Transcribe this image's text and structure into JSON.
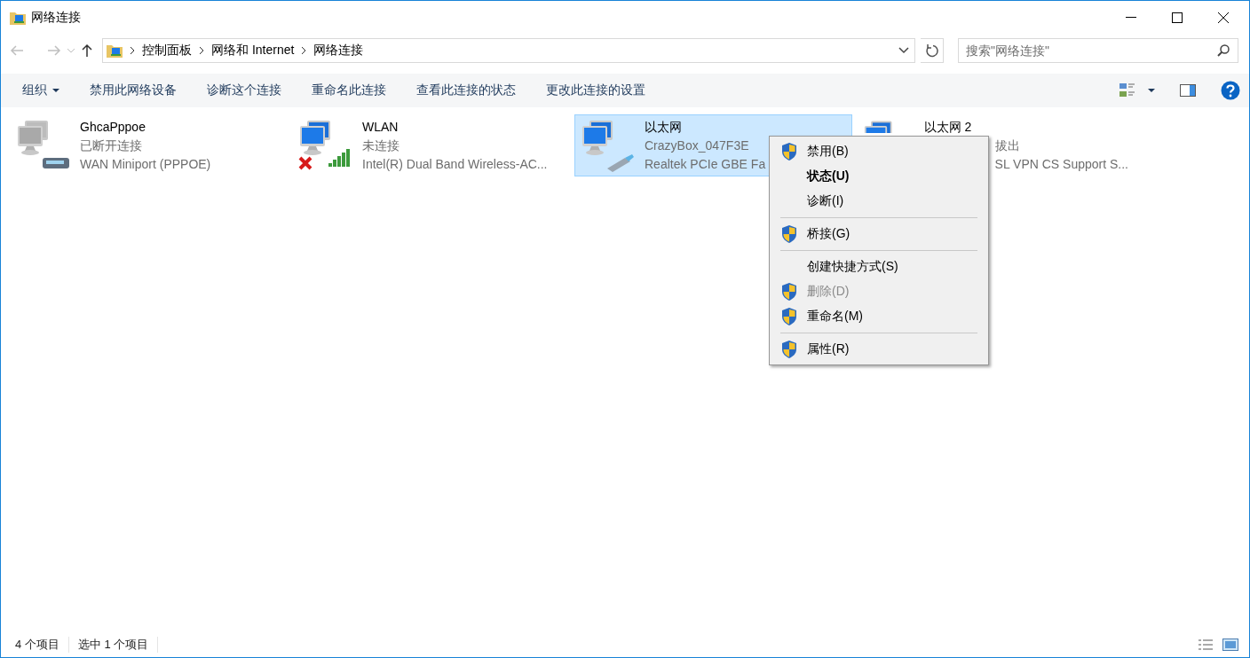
{
  "window": {
    "title": "网络连接"
  },
  "address_bar": {
    "breadcrumbs": [
      "控制面板",
      "网络和 Internet",
      "网络连接"
    ]
  },
  "search": {
    "placeholder": "搜索\"网络连接\""
  },
  "toolbar": {
    "organize": "组织",
    "commands": [
      "禁用此网络设备",
      "诊断这个连接",
      "重命名此连接",
      "查看此连接的状态",
      "更改此连接的设置"
    ]
  },
  "connections": [
    {
      "name": "GhcaPppoe",
      "status": "已断开连接",
      "device": "WAN Miniport (PPPOE)",
      "kind": "dialup",
      "selected": false
    },
    {
      "name": "WLAN",
      "status": "未连接",
      "device": "Intel(R) Dual Band Wireless-AC...",
      "kind": "wireless",
      "selected": false
    },
    {
      "name": "以太网",
      "status": "CrazyBox_047F3E",
      "device": "Realtek PCIe GBE Fa",
      "kind": "ethernet",
      "selected": true
    },
    {
      "name": "以太网 2",
      "status": "拔出",
      "device": "SL VPN CS Support S...",
      "kind": "covered",
      "selected": false
    }
  ],
  "context_menu": [
    {
      "kind": "item",
      "label": "禁用(B)",
      "shield": true,
      "default": false,
      "disabled": false
    },
    {
      "kind": "item",
      "label": "状态(U)",
      "shield": false,
      "default": true,
      "disabled": false
    },
    {
      "kind": "item",
      "label": "诊断(I)",
      "shield": false,
      "default": false,
      "disabled": false
    },
    {
      "kind": "separator"
    },
    {
      "kind": "item",
      "label": "桥接(G)",
      "shield": true,
      "default": false,
      "disabled": false
    },
    {
      "kind": "separator"
    },
    {
      "kind": "item",
      "label": "创建快捷方式(S)",
      "shield": false,
      "default": false,
      "disabled": false
    },
    {
      "kind": "item",
      "label": "删除(D)",
      "shield": true,
      "default": false,
      "disabled": true
    },
    {
      "kind": "item",
      "label": "重命名(M)",
      "shield": true,
      "default": false,
      "disabled": false
    },
    {
      "kind": "separator"
    },
    {
      "kind": "item",
      "label": "属性(R)",
      "shield": true,
      "default": false,
      "disabled": false
    }
  ],
  "status_bar": {
    "count": "4 个项目",
    "selection": "选中 1 个项目"
  }
}
